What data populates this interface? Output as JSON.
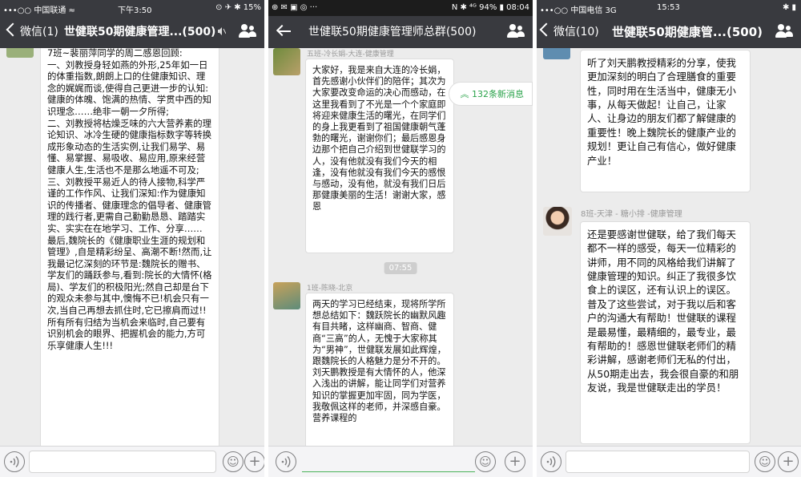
{
  "p1": {
    "status": {
      "carrier": "•••○○ 中国联通 ≈",
      "time": "下午3:50",
      "battery": "⊙ ✈ ✱ 15%"
    },
    "back_label": "微信(1)",
    "title": "世健联50期健康管理...(500)",
    "mute_icon": "mute-icon",
    "message": "7班~裴丽萍同学的周二感恩回顾:\n一、刘教授身轻如燕的外形,25年如一日的体重指数,朗朗上口的住健康知识、理念的娓娓而谈,使得自己更进一步的认知:健康的体魄、饱满的热情、学贯中西的知识理念……绝非一朝一夕所得;\n二、刘教授将枯燥乏味的六大营养素的理论知识、冰冷生硬的健康指标数字等转换成形象动态的生活实例,让我们易学、易懂、易掌握、易吸收、易应用,原来经营健康人生,生活也不是那么地遥不可及;\n三、刘教授平易近人的待人接物,科学严谨的工作作风、让我们深知:作为健康知识的传播者、健康理念的倡导者、健康管理的践行者,更需自己勤勤恳恳、踏踏实实、实实在在地学习、工作、分享……\n最后,魏院长的《健康职业生涯的规划和管理》,自是精彩纷呈、高潮不断!然而,让我最记忆深刻的环节是:魏院长的赠书、学友们的踊跃参与,看到:院长的大情怀(格局)、学友们的积极阳光;然自己却是台下的观众未参与其中,懊悔不已!机会只有一次,当自己再想去抓住时,它已擦肩而过!!\n所有所有归结为当机会来临时,自己要有识别机会的眼界、把握机会的能力,方可乐享健康人生!!!"
  },
  "p2": {
    "status": {
      "left": "⊕ ✉ ▣ ◎ ···",
      "right": "N ✱ ⁴ᴳ 94% ▮ 08:04"
    },
    "title": "世健联50期健康管理师总群(500)",
    "unread": "132条新消息",
    "msg1": {
      "sender": "五班-冷长娟-大连-健康管理",
      "text": "大家好，我是来自大连的冷长娟，首先感谢小伙伴们的陪伴；其次为大家要改变命运的决心而感动，在这里我看到了不光是一个个家庭即将迎来健康生活的曙光，在同学们的身上我更看到了祖国健康朝气蓬勃的曙光，谢谢你们；最后感恩身边那个把自己介绍到世健联学习的人，没有他就没有我们今天的相逢，没有他就没有我们今天的感恨与感动，没有他，就没有我们日后那健康美丽的生活！谢谢大家，感恩"
    },
    "timestamp": "07:55",
    "msg2": {
      "sender": "1班-陈晓-北京",
      "text": "两天的学习已经结束，现将所学所想总结如下：魏跃院长的幽默风趣有目共睹，这样幽商、智商、健商“三高”的人，无愧于大家称其为“男神”，世健联发展如此辉煌，跟魏院长的人格魅力是分不开的。刘天鹏教授是有大情怀的人，他深入浅出的讲解，能让同学们对营养知识的掌握更加牢固，同为学医，我敬佩这样的老师，并深感自豪。营养课程的"
    }
  },
  "p3": {
    "status": {
      "carrier": "•••○○ 中国电信 3G",
      "time": "15:53",
      "battery": "✱ ▮"
    },
    "back_label": "微信(10)",
    "title": "世健联50期健康管...(500)",
    "msg1": {
      "text": "听了刘天鹏教授精彩的分享，使我更加深刻的明白了合理膳食的重要性，同时用在生活当中，健康无小事，从每天做起！让自己，让家人、让身边的朋友们都了解健康的重要性！晚上魏院长的健康产业的规划！更让自己有信心，做好健康产业！"
    },
    "msg2": {
      "sender": "8班-天津 - 糖小排 -健康管理",
      "text": "还是要感谢世健联，给了我们每天都不一样的感受，每天一位精彩的讲师，用不同的风格给我们讲解了健康管理的知识。纠正了我很多饮食上的误区，还有认识上的误区。普及了这些尝试，对于我以后和客户的沟通大有帮助！世健联的课程是最易懂，最精细的，最专业，最有帮助的！感恩世健联老师们的精彩讲解，感谢老师们无私的付出，从50期走出去，我会很自豪的和朋友说，我是世健联走出的学员！"
    }
  },
  "icons": {
    "voice": "voice-icon",
    "emoji": "emoji-icon",
    "plus": "plus-icon",
    "group": "group-members-icon",
    "back": "back-arrow-icon"
  },
  "colors": {
    "navbar": "#393a3f",
    "chat_bg": "#ececec",
    "unread_green": "#2aa34a"
  }
}
